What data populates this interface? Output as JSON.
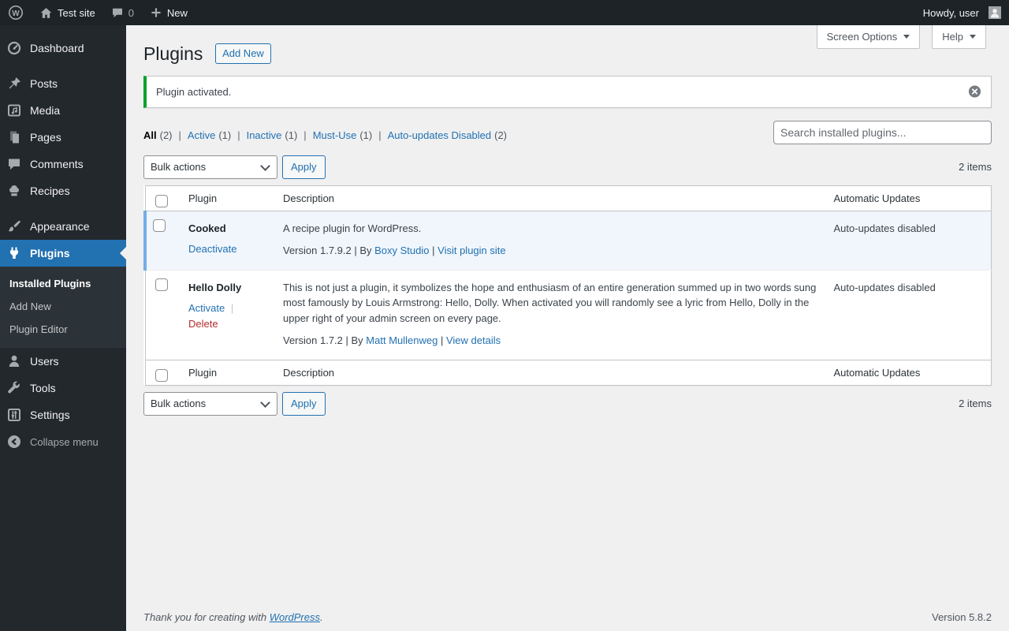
{
  "admin_bar": {
    "site_name": "Test site",
    "comments_count": "0",
    "new_label": "New",
    "howdy_text": "Howdy, user"
  },
  "sidebar": {
    "items": [
      {
        "label": "Dashboard"
      },
      {
        "label": "Posts"
      },
      {
        "label": "Media"
      },
      {
        "label": "Pages"
      },
      {
        "label": "Comments"
      },
      {
        "label": "Recipes"
      },
      {
        "label": "Appearance"
      },
      {
        "label": "Plugins"
      },
      {
        "label": "Users"
      },
      {
        "label": "Tools"
      },
      {
        "label": "Settings"
      }
    ],
    "plugins_submenu": [
      {
        "label": "Installed Plugins"
      },
      {
        "label": "Add New"
      },
      {
        "label": "Plugin Editor"
      }
    ],
    "collapse_label": "Collapse menu"
  },
  "tabs": {
    "screen_options": "Screen Options",
    "help": "Help"
  },
  "header": {
    "title": "Plugins",
    "add_new": "Add New"
  },
  "notice": {
    "message": "Plugin activated."
  },
  "list_nav": {
    "sep": "|",
    "filters": [
      {
        "label": "All",
        "count": "(2)"
      },
      {
        "label": "Active",
        "count": "(1)"
      },
      {
        "label": "Inactive",
        "count": "(1)"
      },
      {
        "label": "Must-Use",
        "count": "(1)"
      },
      {
        "label": "Auto-updates Disabled",
        "count": "(2)"
      }
    ],
    "search_placeholder": "Search installed plugins..."
  },
  "tablenav": {
    "bulk_actions": "Bulk actions",
    "apply": "Apply",
    "count": "2 items"
  },
  "table": {
    "headers": {
      "plugin": "Plugin",
      "description": "Description",
      "auto_updates": "Automatic Updates"
    },
    "rows": [
      {
        "name": "Cooked",
        "actions": {
          "primary": "Deactivate"
        },
        "description": "A recipe plugin for WordPress.",
        "meta": {
          "version_by": "Version 1.7.9.2 | By",
          "author_link": "Boxy Studio",
          "sep": "|",
          "detail_link": "Visit plugin site"
        },
        "auto_updates": "Auto-updates disabled"
      },
      {
        "name": "Hello Dolly",
        "actions": {
          "primary": "Activate",
          "sep": "|",
          "danger": "Delete"
        },
        "description": "This is not just a plugin, it symbolizes the hope and enthusiasm of an entire generation summed up in two words sung most famously by Louis Armstrong: Hello, Dolly. When activated you will randomly see a lyric from Hello, Dolly in the upper right of your admin screen on every page.",
        "meta": {
          "version_by": "Version 1.7.2 | By",
          "author_link": "Matt Mullenweg",
          "sep": "|",
          "detail_link": "View details"
        },
        "auto_updates": "Auto-updates disabled"
      }
    ]
  },
  "footer": {
    "thanks_prefix": "Thank you for creating with",
    "wordpress_link": "WordPress",
    "suffix": ".",
    "version": "Version 5.8.2"
  },
  "colors": {
    "accent": "#2271b1",
    "success_green": "#00a32a",
    "delete_red": "#b32d2e",
    "active_row_bg": "#f0f6fc",
    "active_row_border": "#72aee6"
  }
}
